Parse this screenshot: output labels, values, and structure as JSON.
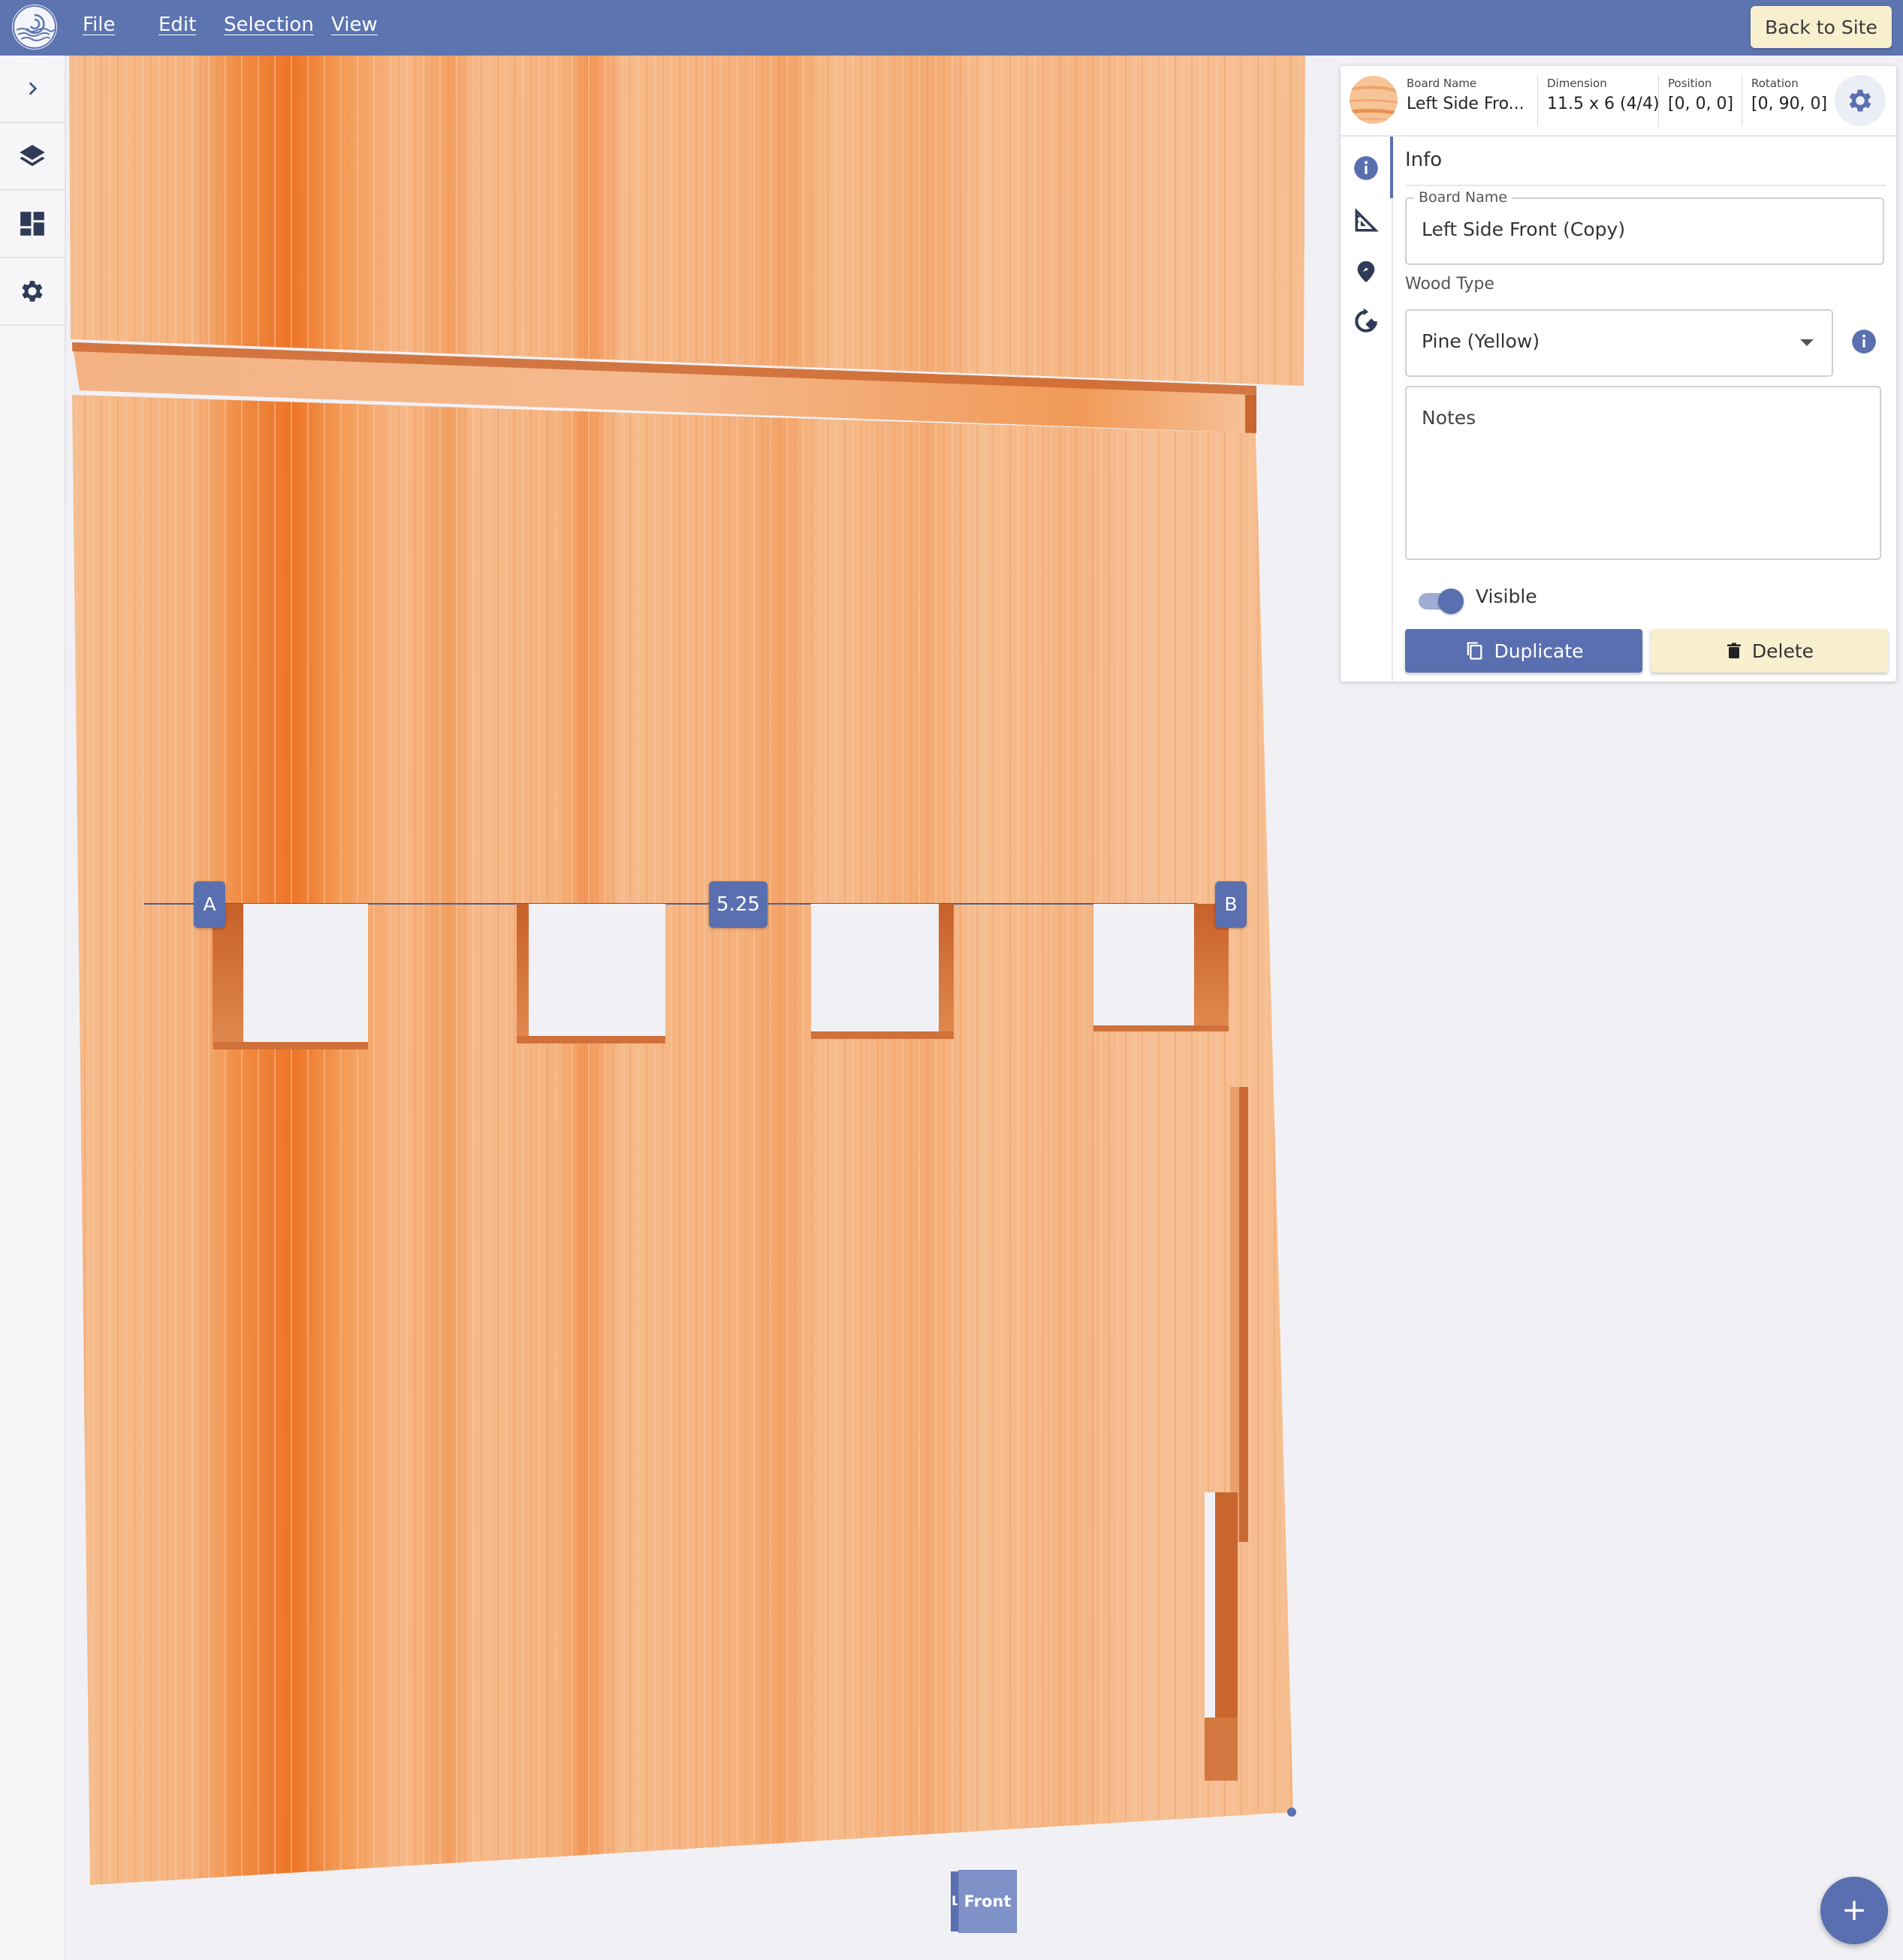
{
  "menu": {
    "file": "File",
    "edit": "Edit",
    "selection": "Selection",
    "view": "View"
  },
  "back_button": "Back to Site",
  "rail": {
    "expand_icon": "chevron-right-icon",
    "layers_icon": "layers-icon",
    "dashboard_icon": "dashboard-icon",
    "settings_icon": "gear-icon"
  },
  "measure": {
    "point_a": "A",
    "point_b": "B",
    "dimension": "5.25"
  },
  "view_cube": {
    "front": "Front",
    "side": "Left"
  },
  "panel": {
    "header": {
      "board_name_label": "Board Name",
      "board_name_value": "Left Side Fro...",
      "dimension_label": "Dimension",
      "dimension_value": "11.5 x 6 (4/4)",
      "position_label": "Position",
      "position_value": "[0, 0, 0]",
      "rotation_label": "Rotation",
      "rotation_value": "[0, 90, 0]"
    },
    "tabs": [
      "info-icon",
      "ruler-icon",
      "map-pin-icon",
      "rotate-icon"
    ],
    "section_title": "Info",
    "board_name_label": "Board Name",
    "board_name": "Left Side Front (Copy)",
    "wood_type_label": "Wood Type",
    "wood_type": "Pine (Yellow)",
    "notes_placeholder": "Notes",
    "visible_label": "Visible",
    "visible": true,
    "duplicate_label": "Duplicate",
    "delete_label": "Delete"
  },
  "colors": {
    "primary": "#5c74b0",
    "accent_button": "#f8efcf",
    "wood_light": "#f6bd8e",
    "wood_grain": "#f0762a"
  }
}
